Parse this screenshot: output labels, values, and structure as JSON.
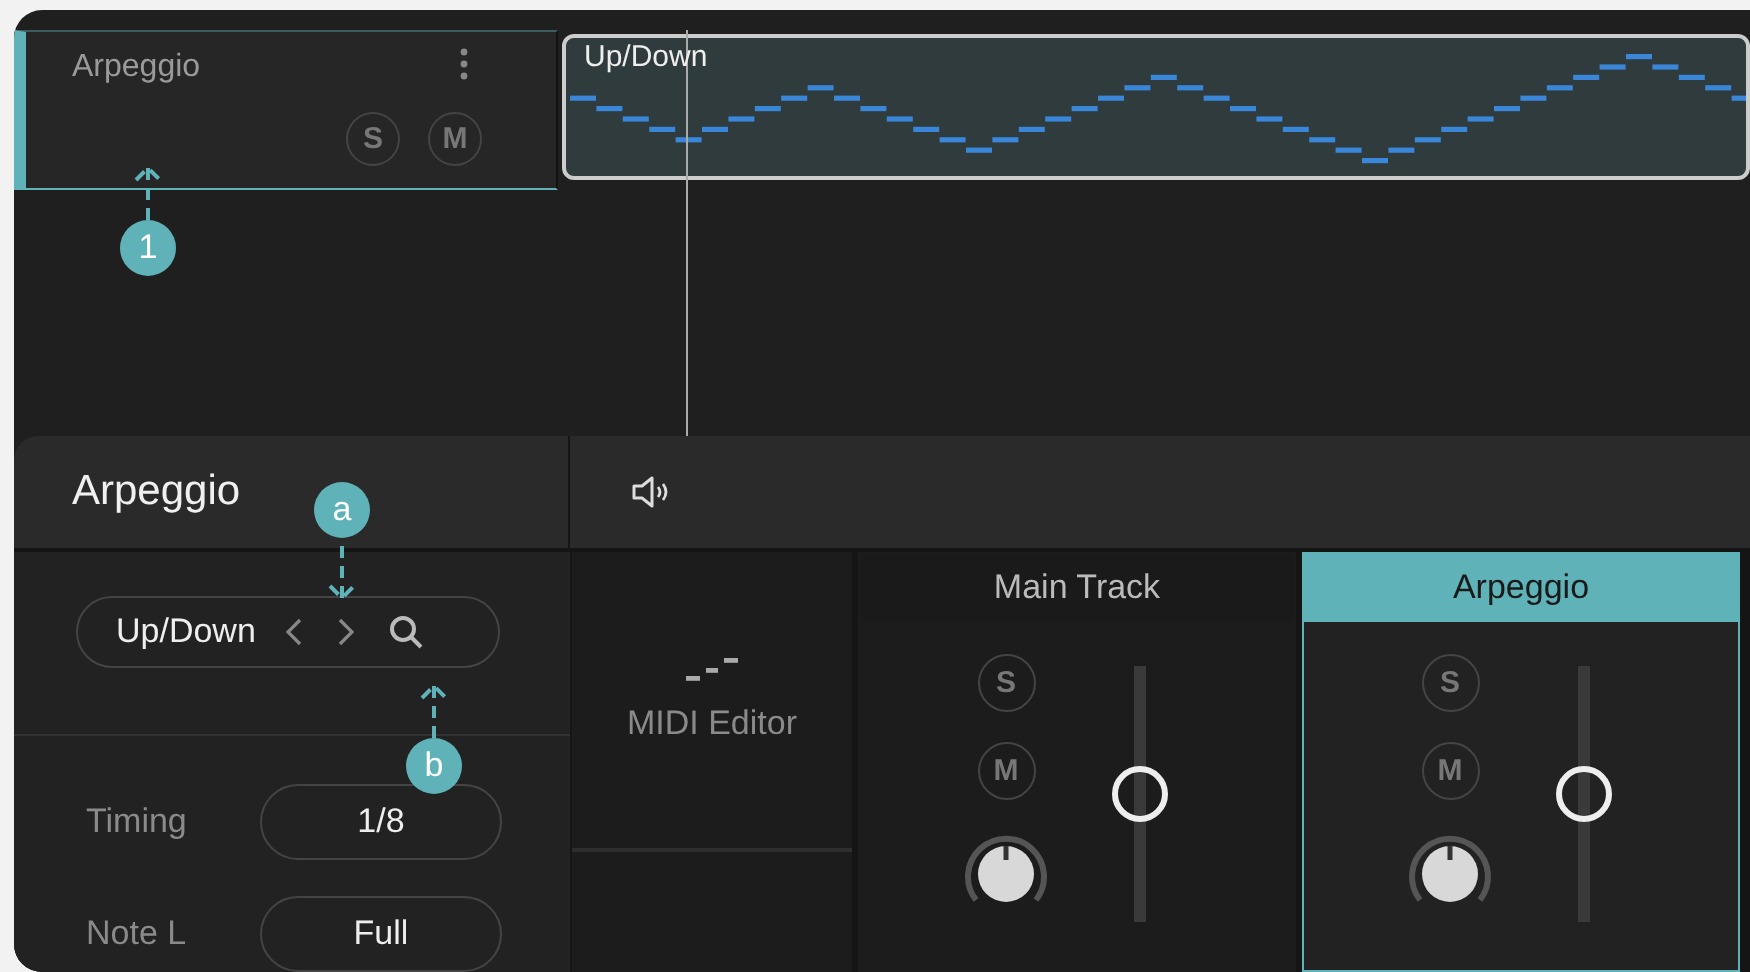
{
  "track": {
    "name": "Arpeggio",
    "selected": true,
    "solo": "S",
    "mute": "M",
    "clip": {
      "title": "Up/Down"
    }
  },
  "callouts": [
    {
      "label": "1"
    },
    {
      "label": "a"
    },
    {
      "label": "b"
    }
  ],
  "inspector": {
    "title": "Arpeggio",
    "preset": "Up/Down",
    "fields": [
      {
        "label": "Timing",
        "value": "1/8"
      },
      {
        "label": "Note L",
        "value": "Full"
      }
    ]
  },
  "editor_tab": {
    "label": "MIDI Editor"
  },
  "mixer": [
    {
      "name": "Main Track",
      "selected": false,
      "solo": "S",
      "mute": "M",
      "level": 0.5
    },
    {
      "name": "Arpeggio",
      "selected": true,
      "solo": "S",
      "mute": "M",
      "level": 0.5
    }
  ]
}
